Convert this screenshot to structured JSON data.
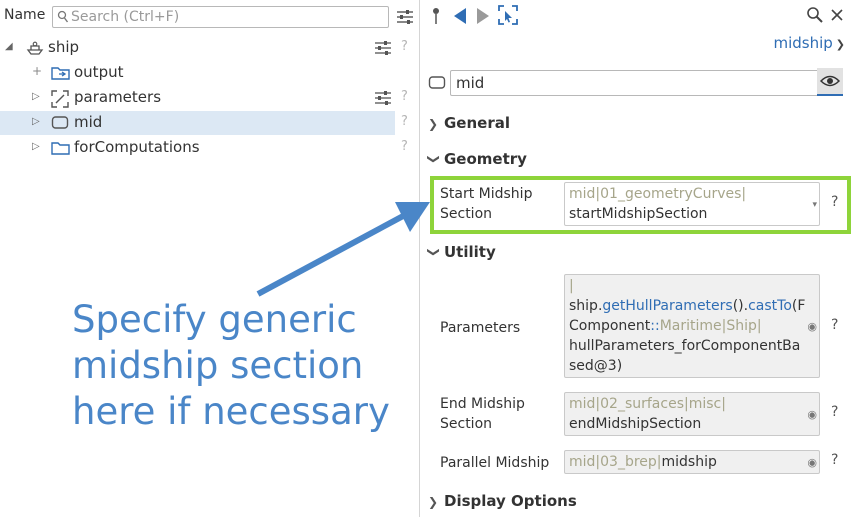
{
  "tree_panel": {
    "name_label": "Name",
    "search_placeholder": "Search (Ctrl+F)",
    "items": [
      {
        "label": "ship",
        "help": "?"
      },
      {
        "label": "output"
      },
      {
        "label": "parameters",
        "help": "?"
      },
      {
        "label": "mid",
        "help": "?"
      },
      {
        "label": "forComputations",
        "help": "?"
      }
    ]
  },
  "properties_panel": {
    "context_dropdown": "midship",
    "object_name": "mid",
    "sections": {
      "general": "General",
      "geometry": "Geometry",
      "utility": "Utility",
      "display_options": "Display Options"
    },
    "props": {
      "start_midship": {
        "label_line1": "Start Midship",
        "label_line2": "Section",
        "val_a": "mid",
        "val_sep1": "|",
        "val_b": "01_geometryCurves",
        "val_sep2": "|",
        "val_c": "startMidshipSection",
        "help": "?"
      },
      "parameters": {
        "label": "Parameters",
        "line0": "|",
        "p1": "ship.",
        "p2": "getHullParameters",
        "p3": "().",
        "p4": "castTo",
        "p5": "(F",
        "p6": "Component",
        "p7": "::",
        "p8": "Maritime",
        "p9": "|",
        "p10": "Ship",
        "p11": "|",
        "p12": "hullParameters_forComponentBa",
        "p13": "sed@3)",
        "help": "?"
      },
      "end_midship": {
        "label_line1": "End Midship",
        "label_line2": "Section",
        "val_a": "mid",
        "val_sep1": "|",
        "val_b": "02_surfaces",
        "val_sep2": "|",
        "val_c": "misc",
        "val_sep3": "|",
        "val_d": "endMidshipSection",
        "help": "?"
      },
      "parallel_midship": {
        "label": "Parallel Midship",
        "val_a": "mid",
        "val_sep1": "|",
        "val_b": "03_brep",
        "val_sep2": "|",
        "val_c": "midship",
        "help": "?"
      }
    }
  },
  "annotation": {
    "line1": "Specify generic",
    "line2": "midship section",
    "line3": "here if necessary"
  },
  "colors": {
    "accent_blue": "#2f6db4",
    "highlight_green": "#8ed43a",
    "annotation_blue": "#4a86c8",
    "selection_bg": "#dce8f4"
  }
}
